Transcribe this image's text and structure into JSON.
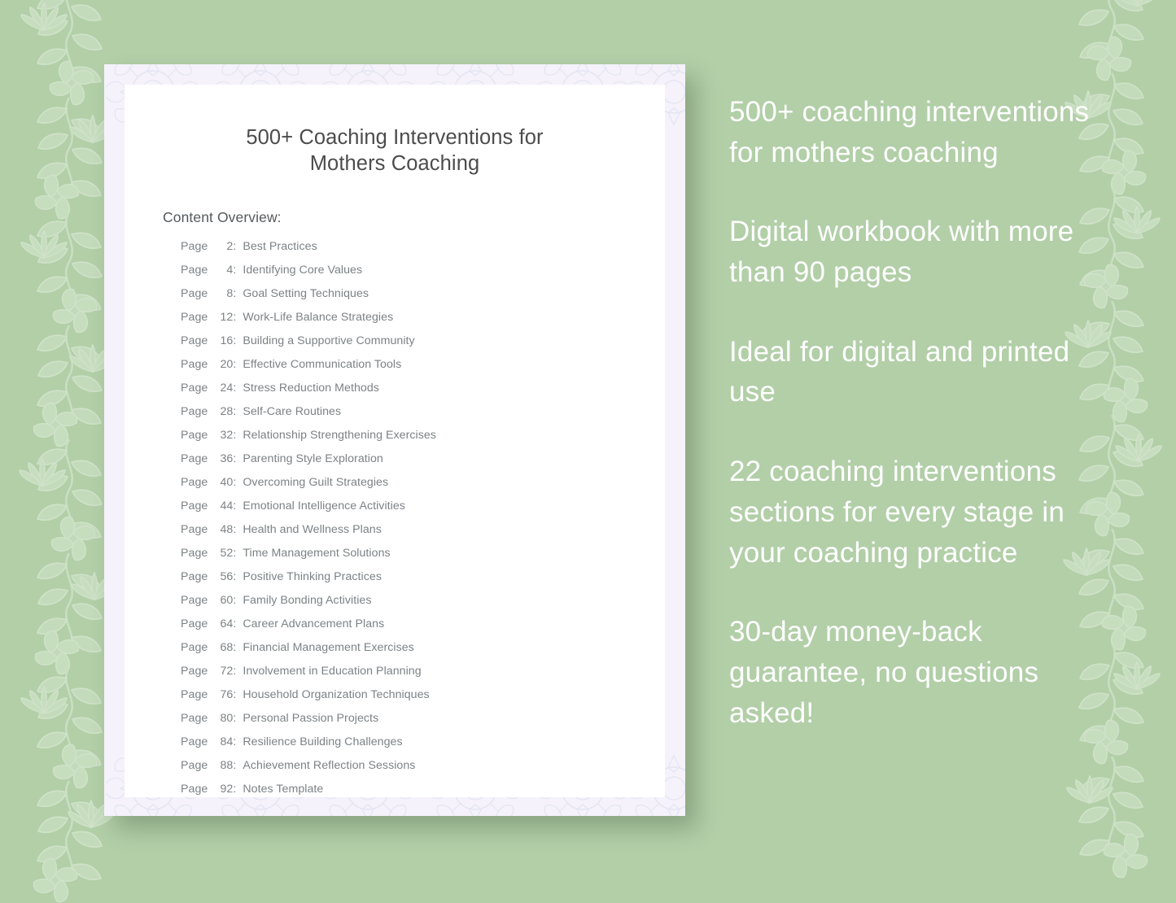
{
  "theme": {
    "background_green": "#b2cfa8",
    "card_mat": "#f5f2fb",
    "sheet_white": "#ffffff",
    "title_text": "#4c4c4c",
    "list_text": "#7d8285",
    "promo_text": "#ffffff"
  },
  "card": {
    "title": "500+ Coaching Interventions for Mothers Coaching",
    "title_line1": "500+ Coaching Interventions for",
    "title_line2": "Mothers Coaching",
    "overview_label": "Content Overview:",
    "page_word": "Page",
    "colon": ":",
    "toc": [
      {
        "page": "2",
        "entry": "Best Practices"
      },
      {
        "page": "4",
        "entry": "Identifying Core Values"
      },
      {
        "page": "8",
        "entry": "Goal Setting Techniques"
      },
      {
        "page": "12",
        "entry": "Work-Life Balance Strategies"
      },
      {
        "page": "16",
        "entry": "Building a Supportive Community"
      },
      {
        "page": "20",
        "entry": "Effective Communication Tools"
      },
      {
        "page": "24",
        "entry": "Stress Reduction Methods"
      },
      {
        "page": "28",
        "entry": "Self-Care Routines"
      },
      {
        "page": "32",
        "entry": "Relationship Strengthening Exercises"
      },
      {
        "page": "36",
        "entry": "Parenting Style Exploration"
      },
      {
        "page": "40",
        "entry": "Overcoming Guilt Strategies"
      },
      {
        "page": "44",
        "entry": "Emotional Intelligence Activities"
      },
      {
        "page": "48",
        "entry": "Health and Wellness Plans"
      },
      {
        "page": "52",
        "entry": "Time Management Solutions"
      },
      {
        "page": "56",
        "entry": "Positive Thinking Practices"
      },
      {
        "page": "60",
        "entry": "Family Bonding Activities"
      },
      {
        "page": "64",
        "entry": "Career Advancement Plans"
      },
      {
        "page": "68",
        "entry": "Financial Management Exercises"
      },
      {
        "page": "72",
        "entry": "Involvement in Education Planning"
      },
      {
        "page": "76",
        "entry": "Household Organization Techniques"
      },
      {
        "page": "80",
        "entry": "Personal Passion Projects"
      },
      {
        "page": "84",
        "entry": "Resilience Building Challenges"
      },
      {
        "page": "88",
        "entry": "Achievement Reflection Sessions"
      },
      {
        "page": "92",
        "entry": "Notes Template"
      }
    ]
  },
  "promo": {
    "blocks": [
      "500+ coaching interventions for mothers coaching",
      "Digital workbook with more than 90 pages",
      "Ideal for digital and printed use",
      "22 coaching interventions sections for every stage in your coaching practice",
      "30-day money-back guarantee, no questions asked!"
    ]
  },
  "decor": {
    "left_vine": "floral-vine-border-icon",
    "right_vine": "floral-vine-border-icon",
    "top_mandala": "mandala-watermark-icon",
    "bottom_mandala": "mandala-watermark-icon"
  }
}
